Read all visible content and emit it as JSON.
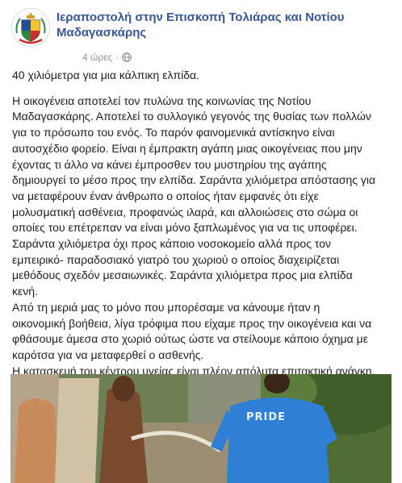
{
  "post": {
    "page_name_lines": [
      "Ιεραποστολή στην Επισκοπή Τολιάρας και Νοτίου",
      "Μαδαγασκάρης"
    ],
    "timestamp": "4 ώρες",
    "separator": "·",
    "privacy_icon": "globe-icon",
    "avatar_icon": "coat-of-arms-logo",
    "lines": [
      "40 χιλιόμετρα για μια κάλπικη ελπίδα.",
      "",
      "Η οικογένεια αποτελεί τον πυλώνα της κοινωνίας της Νοτίου",
      "Μαδαγασκάρης. Αποτελεί το συλλογικό γεγονός της θυσίας των πολλών",
      "για το πρόσωπο του ενός. Το παρόν φαινομενικά αντίσκηνο είναι",
      "αυτοσχέδιο φορείο. Είναι η έμπρακτη αγάπη μιας οικογένειας που μην",
      "έχοντας τι άλλο να κάνει έμπροσθεν του μυστηρίου της αγάπης",
      "δημιουργεί το μέσο προς την ελπίδα. Σαράντα χιλιόμετρα απόστασης για",
      "να μεταφέρουν έναν άνθρωπο ο οποίος ήταν εμφανές ότι είχε",
      "μολυσματική ασθένεια, προφανώς ιλαρά, και αλλοιώσεις στο σώμα οι",
      "οποίες του επέτρεπαν να είναι μόνο ξαπλωμένος για να τις υποφέρει.",
      "Σαράντα χιλιόμετρα όχι προς κάποιο νοσοκομείο αλλά προς τον",
      "εμπειρικό- παραδοσιακό γιατρό του χωριού ο οποίος διαχειρίζεται",
      "μεθόδους σχεδόν μεσαιωνικές. Σαράντα χιλιόμετρα προς μια ελπίδα",
      "κενή.",
      "Από τη μεριά μας το μόνο που μπορέσαμε να κάνουμε ήταν η",
      "οικονομική βοήθεια, λίγα τρόφιμα που είχαμε προς την οικογένεια και να",
      "φθάσουμε άμεσα στο χωριό ούτως ώστε να στείλουμε κάποιο όχημα με",
      "καρότσα για να μεταφερθεί ο ασθενής.",
      "Η κατασκευή του κέντρου υγείας είναι πλέον απόλυτα επιτακτική ανάγκη."
    ],
    "photo": {
      "shirt_text": "PRIDE",
      "colors": {
        "link": "#385898",
        "shirt": "#2f7fd6",
        "foliage": "#5c7a3a"
      }
    }
  }
}
